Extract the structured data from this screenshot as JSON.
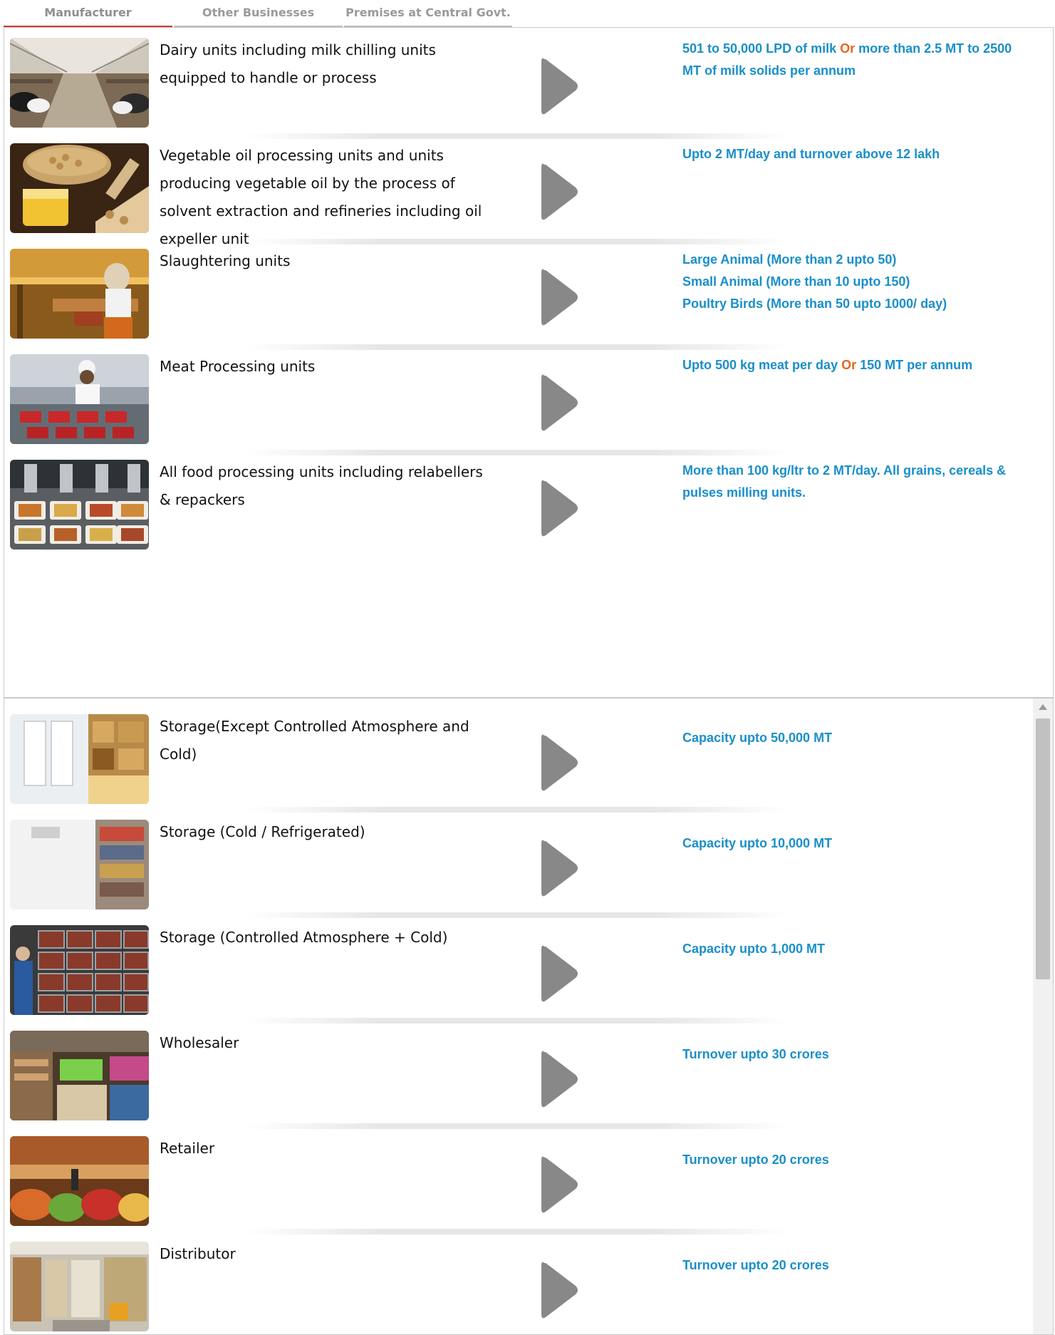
{
  "tabs": [
    {
      "label": "Manufacturer",
      "active": true
    },
    {
      "label": "Other Businesses",
      "active": false
    },
    {
      "label": "Premises at Central Govt.",
      "active": false
    }
  ],
  "colors": {
    "accent": "#d9342b",
    "value_text": "#1a8fc9",
    "or_text": "#e8631f",
    "arrow": "#888888"
  },
  "manufacturer": {
    "rows": [
      {
        "title": "Dairy units including milk chilling units equipped to handle or process",
        "value_parts": [
          "501 to 50,000 LPD of milk ",
          "Or",
          " more than 2.5 MT to 2500 MT of milk solids per annum"
        ]
      },
      {
        "title": "Vegetable oil processing units and units producing vegetable oil by the process of solvent extraction and refineries including oil expeller unit",
        "value_parts": [
          "Upto 2 MT/day and turnover above 12 lakh"
        ]
      },
      {
        "title": "Slaughtering units",
        "value_lines": [
          "Large Animal (More than 2 upto 50)",
          "Small Animal (More than 10 upto 150)",
          "Poultry Birds (More than 50 upto 1000/ day)"
        ]
      },
      {
        "title": "Meat Processing units",
        "value_parts": [
          "Upto 500 kg meat per day ",
          "Or",
          " 150 MT per annum"
        ]
      },
      {
        "title": "All food processing units including relabellers & repackers",
        "value_parts": [
          "More than 100 kg/ltr to 2 MT/day. All grains, cereals & pulses milling units."
        ]
      }
    ]
  },
  "other_businesses": {
    "rows": [
      {
        "title": "Storage(Except Controlled Atmosphere and Cold)",
        "value": "Capacity upto 50,000 MT"
      },
      {
        "title": "Storage (Cold / Refrigerated)",
        "value": "Capacity upto 10,000 MT"
      },
      {
        "title": "Storage (Controlled Atmosphere + Cold)",
        "value": "Capacity upto 1,000 MT"
      },
      {
        "title": "Wholesaler",
        "value": "Turnover upto 30 crores"
      },
      {
        "title": "Retailer",
        "value": "Turnover upto 20 crores"
      },
      {
        "title": "Distributor",
        "value": "Turnover upto 20 crores"
      }
    ]
  }
}
